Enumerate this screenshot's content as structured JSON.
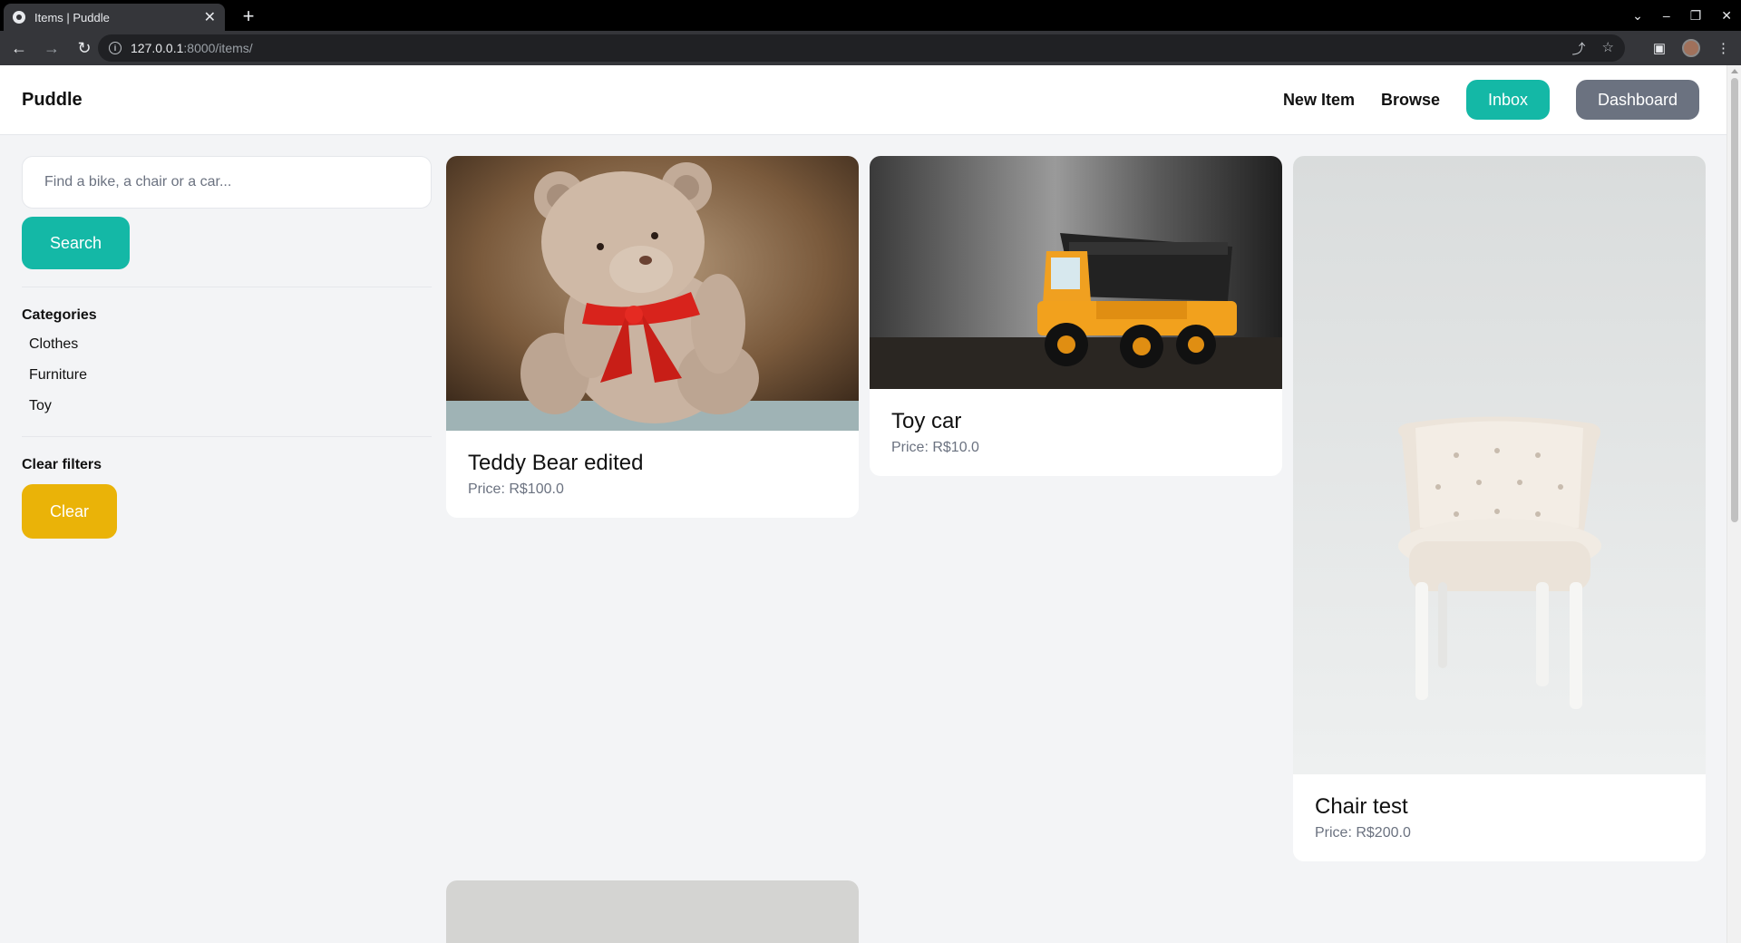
{
  "browser": {
    "tab_title": "Items | Puddle",
    "url_host": "127.0.0.1",
    "url_path": ":8000/items/"
  },
  "nav": {
    "brand": "Puddle",
    "new_item": "New Item",
    "browse": "Browse",
    "inbox": "Inbox",
    "dashboard": "Dashboard"
  },
  "sidebar": {
    "search_placeholder": "Find a bike, a chair or a car...",
    "search_button": "Search",
    "categories_title": "Categories",
    "categories": [
      "Clothes",
      "Furniture",
      "Toy"
    ],
    "clear_title": "Clear filters",
    "clear_button": "Clear"
  },
  "items": [
    {
      "title": "Teddy Bear edited",
      "price": "Price: R$100.0",
      "image": "teddy-bear-photo"
    },
    {
      "title": "Toy car",
      "price": "Price: R$10.0",
      "image": "toy-truck-photo"
    },
    {
      "title": "Chair test",
      "price": "Price: R$200.0",
      "image": "white-chair-photo"
    }
  ],
  "colors": {
    "accent": "#14b8a6",
    "dashboard": "#6b7280",
    "clear": "#eab308",
    "background": "#f3f4f6"
  }
}
